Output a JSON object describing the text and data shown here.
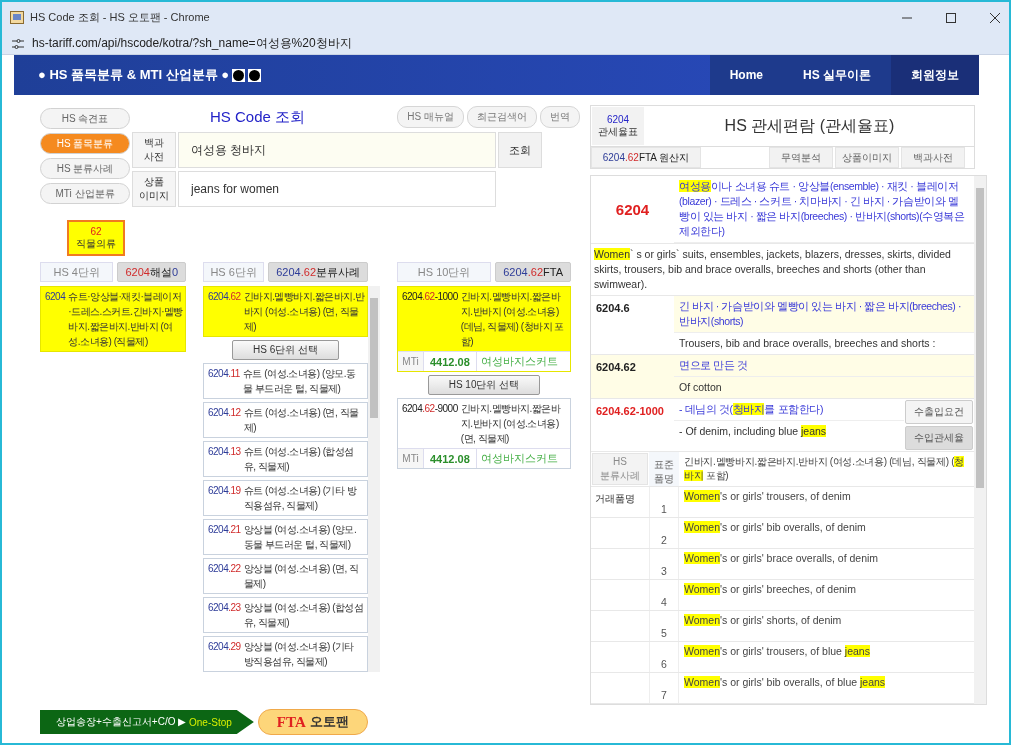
{
  "window": {
    "title": "HS Code 조회 - HS 오토팬 - Chrome",
    "url": "hs-tariff.com/api/hscode/kotra/?sh_name=여성용%20청바지"
  },
  "header": {
    "brand": "● HS 품목분류 & MTI 산업분류 ●",
    "nav": [
      {
        "label": "Home",
        "selected": false
      },
      {
        "label": "HS 실무이론",
        "selected": false
      },
      {
        "label": "회원정보",
        "selected": true
      }
    ]
  },
  "side_nav": [
    {
      "label": "HS 속견표",
      "selected": false
    },
    {
      "label": "HS 품목분류",
      "selected": true
    },
    {
      "label": "HS 분류사례",
      "selected": false
    },
    {
      "label": "MTi 산업분류",
      "selected": false
    }
  ],
  "title": "HS Code 조회",
  "tool_buttons": [
    "HS 매뉴얼",
    "최근검색어",
    "번역"
  ],
  "search_rows": [
    {
      "label": "백과\n사전",
      "value": "여성용 청바지",
      "focused": true,
      "button": "조회"
    },
    {
      "label": "상품\n이미지",
      "value": "jeans for women",
      "focused": false
    }
  ],
  "chapter": {
    "code": "62",
    "name": "직물의류"
  },
  "columns": [
    {
      "header": "HS 4단위",
      "tab": [
        {
          "kind": "accent",
          "text": "6204"
        },
        {
          "kind": "plain",
          "text": " 해설 "
        },
        {
          "kind": "primary",
          "text": "0"
        }
      ],
      "items": [
        {
          "selected": true,
          "code": [
            {
              "kind": "primary",
              "text": "6204"
            }
          ],
          "desc": "슈트·앙상블·재킷·블레이저·드레스.스커트.긴바지·멜빵바지.짧은바지.반바지 (여성.소녀용) (직물제)"
        }
      ]
    },
    {
      "header": "HS 6단위",
      "tab": [
        {
          "kind": "primary",
          "text": "6204"
        },
        {
          "kind": "accent",
          "text": ".62"
        },
        {
          "kind": "plain",
          "text": " 분류사례"
        }
      ],
      "select_button": "HS 6단위 선택",
      "scroll": true,
      "items": [
        {
          "selected": true,
          "code": [
            {
              "kind": "primary",
              "text": "6204"
            },
            {
              "kind": "accent",
              "text": ".62"
            }
          ],
          "desc": "긴바지.멜빵바지.짧은바지.반바지 (여성.소녀용) (면, 직물제)"
        },
        {
          "selected": false,
          "code": [
            {
              "kind": "primary",
              "text": "6204"
            },
            {
              "kind": "accent",
              "text": ".11"
            }
          ],
          "desc": "슈트 (여성.소녀용) (양모.동물 부드러운 털, 직물제)"
        },
        {
          "selected": false,
          "code": [
            {
              "kind": "primary",
              "text": "6204"
            },
            {
              "kind": "accent",
              "text": ".12"
            }
          ],
          "desc": "슈트 (여성.소녀용) (면, 직물제)"
        },
        {
          "selected": false,
          "code": [
            {
              "kind": "primary",
              "text": "6204"
            },
            {
              "kind": "accent",
              "text": ".13"
            }
          ],
          "desc": "슈트 (여성.소녀용) (합성섬유, 직물제)"
        },
        {
          "selected": false,
          "code": [
            {
              "kind": "primary",
              "text": "6204"
            },
            {
              "kind": "accent",
              "text": ".19"
            }
          ],
          "desc": "슈트 (여성.소녀용) (기타 방직용섬유, 직물제)"
        },
        {
          "selected": false,
          "code": [
            {
              "kind": "primary",
              "text": "6204"
            },
            {
              "kind": "accent",
              "text": ".21"
            }
          ],
          "desc": "앙상블 (여성.소녀용) (양모.동물 부드러운 털, 직물제)"
        },
        {
          "selected": false,
          "code": [
            {
              "kind": "primary",
              "text": "6204"
            },
            {
              "kind": "accent",
              "text": ".22"
            }
          ],
          "desc": "앙상블 (여성.소녀용) (면, 직물제)"
        },
        {
          "selected": false,
          "code": [
            {
              "kind": "primary",
              "text": "6204"
            },
            {
              "kind": "accent",
              "text": ".23"
            }
          ],
          "desc": "앙상블 (여성.소녀용) (합성섬유, 직물제)"
        },
        {
          "selected": false,
          "code": [
            {
              "kind": "primary",
              "text": "6204"
            },
            {
              "kind": "accent",
              "text": ".29"
            }
          ],
          "desc": "앙상블 (여성.소녀용) (기타 방직용섬유, 직물제)"
        }
      ]
    },
    {
      "header": "HS 10단위",
      "tab": [
        {
          "kind": "primary",
          "text": "6204"
        },
        {
          "kind": "accent",
          "text": ".62"
        },
        {
          "kind": "plain",
          "text": " FTA"
        }
      ],
      "select_button": "HS 10단위 선택",
      "items": [
        {
          "selected": true,
          "code": [
            {
              "kind": "plain",
              "text": "6204"
            },
            {
              "kind": "accent",
              "text": ".62"
            },
            {
              "kind": "plain",
              "text": "-1000"
            }
          ],
          "desc": "긴바지.멜빵바지.짧은바지.반바지 (여성.소녀용) (데님, 직물제) (청바지 포함)",
          "mti": {
            "label": "MTi",
            "code": "4412.08",
            "name": "여성바지스커트"
          }
        },
        {
          "selected": false,
          "code": [
            {
              "kind": "plain",
              "text": "6204"
            },
            {
              "kind": "accent",
              "text": ".62"
            },
            {
              "kind": "plain",
              "text": "-9000"
            }
          ],
          "desc": "긴바지.멜빵바지.짧은바지.반바지 (여성.소녀용) (면, 직물제)",
          "mti": {
            "label": "MTi",
            "code": "4412.08",
            "name": "여성바지스커트"
          }
        }
      ]
    }
  ],
  "tariff": {
    "code": "6204",
    "code_label": "관세율표",
    "title": "HS 관세편람 (관세율표)",
    "origin_tab": [
      {
        "kind": "primary",
        "text": "6204"
      },
      {
        "kind": "accent",
        "text": ".62"
      },
      {
        "kind": "plain",
        "text": " FTA 원산지"
      }
    ],
    "tabs": [
      "무역분석",
      "상품이미지",
      "백과사전"
    ],
    "rows": [
      {
        "kind": "heading",
        "code": "6204",
        "ko": "**여성용**이나 소녀용 슈트 · 앙상블(ensemble) · 재킷 · 블레이저(blazer) · 드레스 · 스커트 · 치마바지 · 긴 바지 · 가슴받이와 멜빵이 있는 바지 · 짧은 바지(breeches) · 반바지(shorts)(수영복은 제외한다)",
        "en": "**Women**` s or girls` suits, ensembles, jackets, blazers, dresses, skirts, divided skirts, trousers, bib and brace overalls, breeches and shorts (other than swimwear)."
      },
      {
        "kind": "subheading",
        "shaded": false,
        "code": "6204.6",
        "ko": "긴 바지 · 가슴받이와 멜빵이 있는 바지 · 짧은 바지(breeches) · 반바지(shorts)",
        "en": "Trousers, bib and brace overalls, breeches and shorts :"
      },
      {
        "kind": "subheading",
        "shaded": true,
        "code": "6204.62",
        "ko": "면으로 만든 것",
        "en": "Of cotton"
      },
      {
        "kind": "tariff_line",
        "code": "6204.62-1000",
        "ko": "- 데님의 것(**청바지**를 포함한다)",
        "en": "- Of denim, including blue **jeans**",
        "buttons": [
          {
            "label": "수출입요건",
            "selected": false
          },
          {
            "label": "수입관세율",
            "selected": true
          }
        ]
      },
      {
        "kind": "standard",
        "button": {
          "label": "HS\n분류사례",
          "disabled": true
        },
        "label": "표준\n품명",
        "text": "긴바지.멜빵바지.짧은바지.반바지 (여성.소녀용) (데님, 직물제) (**청바지** 포함)"
      },
      {
        "kind": "trade",
        "label": "거래품명",
        "items": [
          {
            "number": "1",
            "text": "**Women**'s or girls' trousers, of denim"
          },
          {
            "number": "2",
            "text": "**Women**'s or girls' bib overalls, of denim"
          },
          {
            "number": "3",
            "text": "**Women**'s or girls' brace overalls, of denim"
          },
          {
            "number": "4",
            "text": "**Women**'s or girls' breeches, of denim"
          },
          {
            "number": "5",
            "text": "**Women**'s or girls' shorts, of denim"
          },
          {
            "number": "6",
            "text": "**Women**'s or girls' trousers, of blue **jeans**"
          },
          {
            "number": "7",
            "text": "**Women**'s or girls' bib overalls, of blue **jeans**"
          }
        ]
      }
    ]
  },
  "banner": {
    "text": "상업송장+수출신고서+C/O",
    "arrow": "▶",
    "highlight": "One-Stop",
    "logo_accent": "FTA",
    "logo_text": "오토팬"
  }
}
